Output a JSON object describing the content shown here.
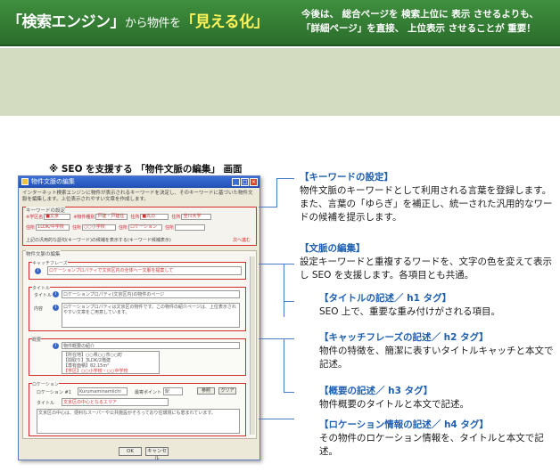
{
  "banner": {
    "title_main": "「検索エンジン」",
    "title_mid": "から物件を",
    "title_tail": "「見える化」",
    "note_line1": "今後は、 総合ページを 検索上位に 表示 させるよりも、",
    "note_line2": "「詳細ページ」を直接、 上位表示 させることが 重要！"
  },
  "caption": "※ SEO を支援する 「物件文脈の編集」 画面",
  "dialog": {
    "title": "物件文脈の編集",
    "intro": "インターネット検索エンジンに物件が表示されるキーワードを決定し、そのキーワードに基づいた物件文脈を編集します。上位表示されやすい文章を作成します。",
    "kw_section": "キーワードの設定",
    "kw_cells": [
      {
        "label": "※学区名",
        "value": "■文京"
      },
      {
        "label": "※物件種別",
        "value": "戸建・戸建住"
      },
      {
        "label": "住所",
        "value": "■丸の"
      },
      {
        "label": "住所",
        "value": "全川大学"
      },
      {
        "label": "住所",
        "value": "1LDK/中学校"
      },
      {
        "label": "住所",
        "value": "○○小学校"
      },
      {
        "label": "住所",
        "value": "ロケーション"
      },
      {
        "label": "住所",
        "value": ""
      }
    ],
    "kw_note": "上記の汎用的な語句(キーワード)の候補を表示する(キーワード候補表示)",
    "kw_red": "次へ進む",
    "ctx_section": "物件文脈の編集",
    "catch_section": "キャッチフレーズ",
    "catch_text": "ロケーションプロパティで文京区内の全体へ一文脈を提案して",
    "title_section": "タイトル",
    "title_label": "タイトル",
    "title_value": "ロケーションプロパティ(文京区内)の物件のページ",
    "body_label": "内容",
    "body_value": "ロケーションプロパティは文京区の物件です。この物件の紹介ページは、上位表示されやすい文章をご用意しています。",
    "summary_section": "概要",
    "summary_title": "物件概要の紹介",
    "summary_lines": [
      "【所在地】○○県○○市○○町",
      "【間取り】3LDK/2階建",
      "【専有面積】82.15m²",
      "【学区】○○小学校・○○中学校"
    ],
    "loc_section": "ロケーション",
    "loc_label": "ロケーション #1",
    "loc_value": "Kurumaminamiichi",
    "loc_point_label": "最寄ポイント",
    "loc_point_value": "駅",
    "loc_title_label": "タイトル",
    "loc_title_value": "文京区の中心となるエリア",
    "loc_body": "文京区の中心は、便利なスーパーや公共施設がそろっており住環境にも恵まれています。",
    "btn_ref": "参照",
    "btn_clear": "クリア",
    "btn_ok": "OK",
    "btn_cancel": "キャンセル"
  },
  "annotations": [
    {
      "head": "【キーワードの設定】",
      "body": "物件文脈のキーワードとして利用される言葉を登録します。また、言葉の「ゆらぎ」を補正し、統一された汎用的なワードの候補を提示します。"
    },
    {
      "head": "【文脈の編集】",
      "body": "設定キーワードと重複するワードを、文字の色を変えて表示し SEO を支援します。各項目とも共通。"
    },
    {
      "head": "【タイトルの記述／ h1 タグ】",
      "body": "SEO 上で、重要な重み付けがされる項目。"
    },
    {
      "head": "【キャッチフレーズの記述／ h2 タグ】",
      "body": "物件の特徴を、簡潔に表すいタイトルキャッチと本文で記述。"
    },
    {
      "head": "【概要の記述／ h3 タグ】",
      "body": "物件概要のタイトルと本文で記述。"
    },
    {
      "head": "【ロケーション情報の記述／ h4 タグ】",
      "body": "その物件のロケーション情報を、タイトルと本文で記述。"
    }
  ],
  "colors": {
    "banner": "#2f7a2f",
    "accent": "#1f5fb0",
    "highlight": "#d62b2b",
    "band": "#d3dcc1"
  }
}
